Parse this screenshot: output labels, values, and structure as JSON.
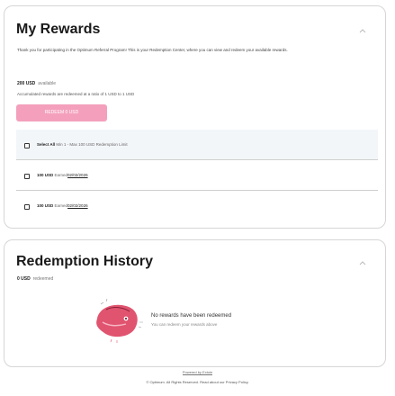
{
  "rewards": {
    "title": "My Rewards",
    "intro": "Thank you for participating in the Optimum Referral Program! This is your Redemption Center, where you can view and redeem your available rewards.",
    "available_amount": "200 USD",
    "available_label": "available",
    "ratio_text": "Accumulated rewards are redeemed at a ratio of 1 USD to 1 USD",
    "redeem_button": "REDEEM 0 USD",
    "select_all_label": "Select All",
    "limit_text": "Min 1 - Max 100 USD Redemption Limit",
    "items": [
      {
        "amount": "100 USD",
        "earned_label": "Earned",
        "date": "02/02/2026"
      },
      {
        "amount": "100 USD",
        "earned_label": "Earned",
        "date": "02/02/2026"
      }
    ]
  },
  "history": {
    "title": "Redemption History",
    "total_amount": "0 USD",
    "total_label": "redeemed",
    "empty_title": "No rewards have been redeemed",
    "empty_subtitle": "You can redeem your rewards above"
  },
  "footer": {
    "powered_by": "Powered by Extole",
    "legal": "© Optimum. All Rights Reserved. Read about our Privacy Policy."
  },
  "colors": {
    "accent_pink": "#f4a0bd",
    "illustration_pink": "#e0546f",
    "row_highlight": "#f3f6f9"
  }
}
